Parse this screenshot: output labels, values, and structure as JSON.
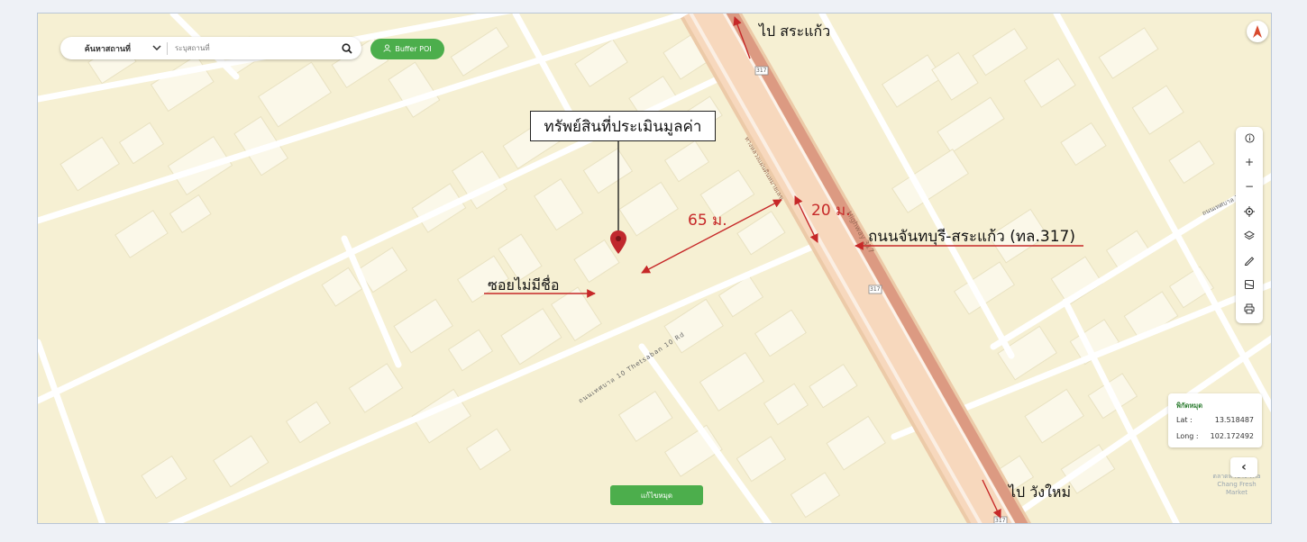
{
  "search": {
    "type_label": "ค้นหาสถานที่",
    "placeholder": "ระบุสถานที่"
  },
  "buffer_button": {
    "label": "Buffer POI"
  },
  "callout": {
    "text": "ทรัพย์สินที่ประเมินมูลค่า"
  },
  "annotations": {
    "to_north": "ไป สระแก้ว",
    "to_south": "ไป วังใหม่",
    "distance_main": "65 ม.",
    "road_width": "20 ม.",
    "main_road": "ถนนจันทบุรี-สระแก้ว (ทล.317)",
    "soi": "ซอยไม่มีชื่อ"
  },
  "map_labels": {
    "highway_thai": "ทางหลวงแผ่นดินหมายเลข",
    "highway_en": "Highway 317",
    "route_shield": "317",
    "thetsaban10": "ถนนเทศบาล 10 Thetsaban 10 Rd",
    "thetsaban7": "ถนนเทศบาล 7",
    "market": "ตลาดท่าช้าง Tha Chang Fresh Market"
  },
  "coordinates": {
    "title": "พิกัดหมุด",
    "lat_label": "Lat :",
    "lat_value": "13.518487",
    "long_label": "Long :",
    "long_value": "102.172492"
  },
  "toolbar": {
    "items": [
      "info-icon",
      "zoom-in-icon",
      "zoom-out-icon",
      "locate-icon",
      "layers-icon",
      "measure-icon",
      "map-style-icon",
      "print-icon"
    ],
    "zoom_in": "+",
    "zoom_out": "−"
  },
  "edit_button": {
    "label": "แก้ไขหมุด"
  },
  "colors": {
    "map_bg": "#f6f0d3",
    "building": "#fbf8e9",
    "road": "#ffffff",
    "highway": "#f7d8bd",
    "highway_center": "#dc9a82",
    "annotation_red": "#c62828",
    "button_green": "#4cae4c"
  }
}
